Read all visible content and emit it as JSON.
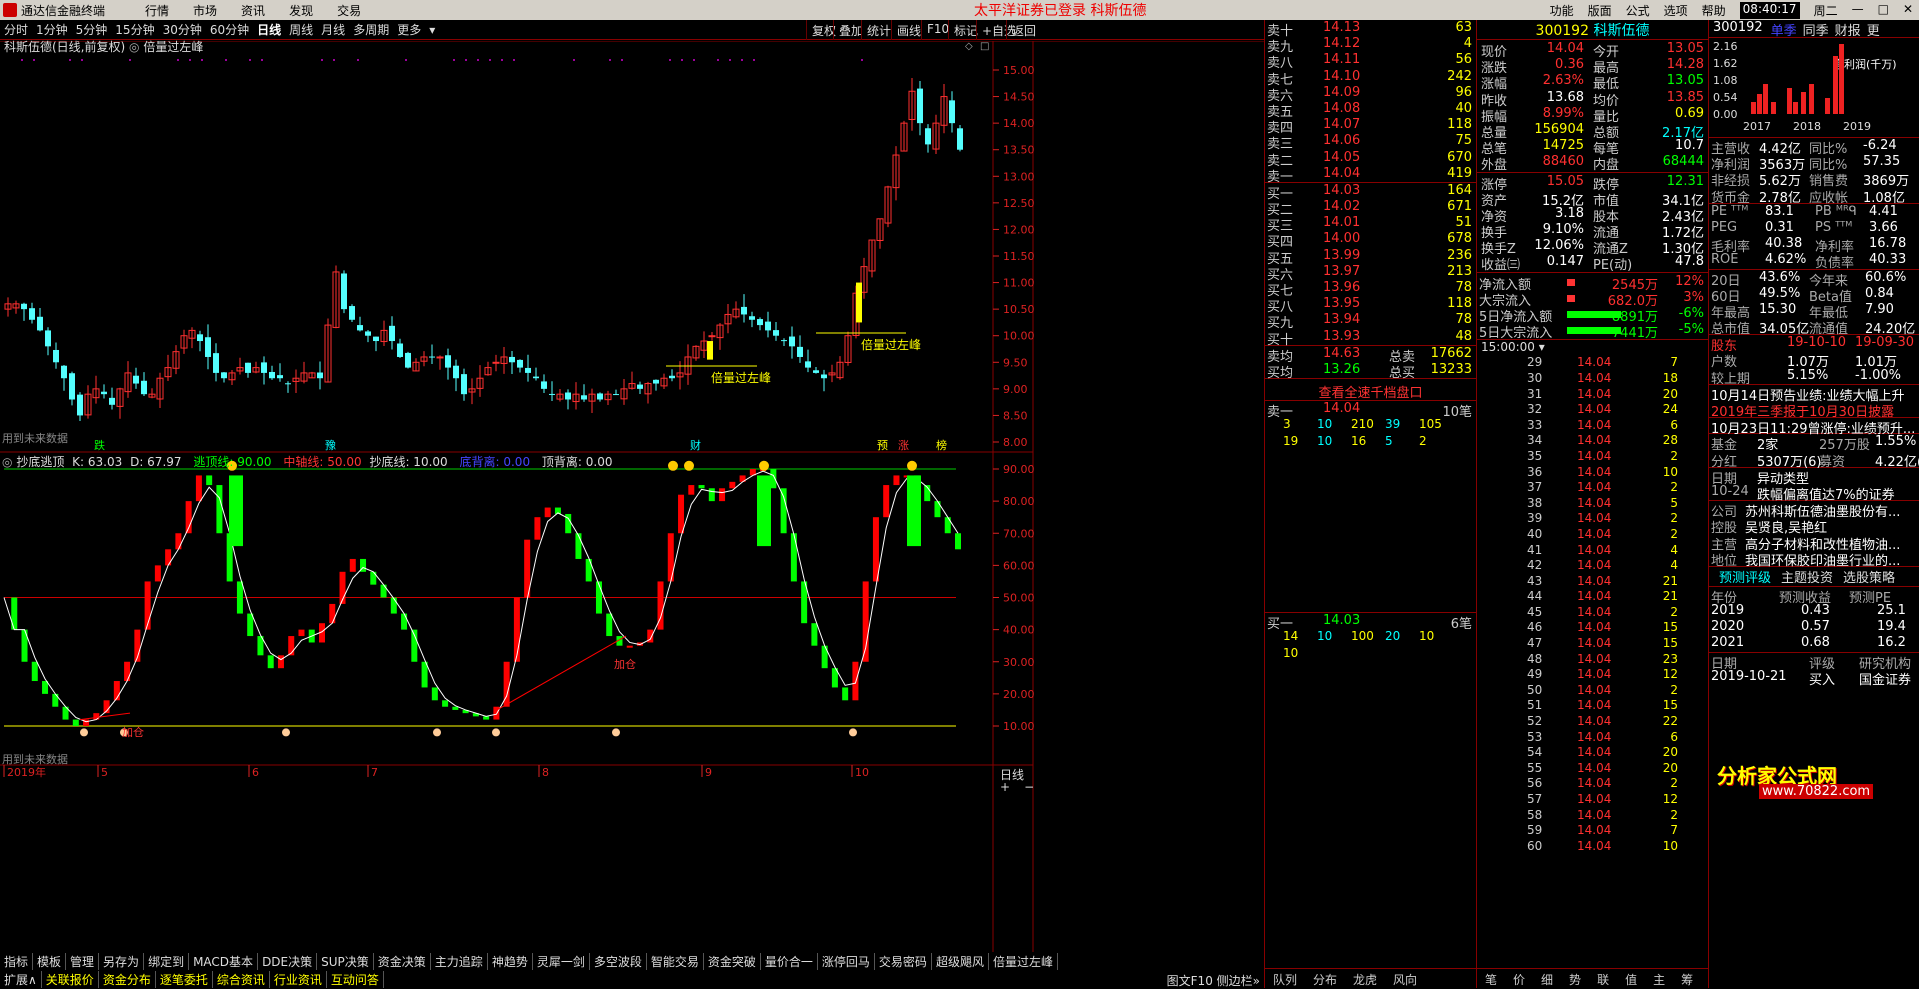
{
  "app": {
    "title": "通达信金融终端",
    "menu": [
      "行情",
      "市场",
      "资讯",
      "发现",
      "交易"
    ],
    "notice": "太平洋证券已登录   科斯伍德",
    "right_menu": [
      "功能",
      "版面",
      "公式",
      "选项",
      "帮助"
    ],
    "clock": "08:40:17",
    "weekday": "周二",
    "win_min": "—",
    "win_max": "□",
    "win_close": "✕"
  },
  "periods": [
    "分时",
    "1分钟",
    "5分钟",
    "15分钟",
    "30分钟",
    "60分钟",
    "日线",
    "周线",
    "月线",
    "多周期",
    "更多"
  ],
  "active_period": "日线",
  "tools": [
    "复权",
    "叠加",
    "统计",
    "画线",
    "F10",
    "标记",
    "+自选",
    "返回"
  ],
  "chart_title": "科斯伍德(日线,前复权)",
  "chart_title_indicator": "倍量过左峰",
  "price_ticks": [
    "15.00",
    "14.50",
    "14.00",
    "13.50",
    "13.00",
    "12.50",
    "12.00",
    "11.50",
    "11.00",
    "10.50",
    "10.00",
    "9.50",
    "9.00",
    "8.50",
    "8.00"
  ],
  "future_text": "用到未来数据",
  "signal_labels": [
    {
      "text": "跌",
      "color": "#0f0"
    },
    {
      "text": "豫",
      "color": "#0ff"
    },
    {
      "text": "财",
      "color": "#0ff"
    },
    {
      "text": "预",
      "color": "#ff0"
    },
    {
      "text": "涨",
      "color": "#f33"
    },
    {
      "text": "榜",
      "color": "#ff0"
    }
  ],
  "annot1": "倍量过左峰",
  "annot2": "倍量过左峰",
  "indicator": {
    "name": "抄底逃顶",
    "k": "K: 63.03",
    "d": "D: 67.97",
    "escape": "逃顶线: 90.00",
    "mid": "中轴线: 50.00",
    "bottom": "抄底线: 10.00",
    "bot_div": "底背离: 0.00",
    "top_div": "顶背离: 0.00",
    "add_label": "加仓",
    "add_label2": "加仓"
  },
  "ind_ticks": [
    "90.00",
    "80.00",
    "70.00",
    "60.00",
    "50.00",
    "40.00",
    "30.00",
    "20.00",
    "10.00"
  ],
  "months": [
    "2019年",
    "5",
    "6",
    "7",
    "8",
    "9",
    "10"
  ],
  "dayline_label": "日线",
  "scroll_btns": [
    "+",
    "−"
  ],
  "bottom_tabs1": [
    "指标",
    "模板",
    "管理",
    "另存为",
    "绑定到",
    "MACD基本",
    "DDE决策",
    "SUP决策",
    "资金决策",
    "主力追踪",
    "神趋势",
    "灵犀一剑",
    "多空波段",
    "智能交易",
    "资金突破",
    "量价合一",
    "涨停回马",
    "交易密码",
    "超级飓风",
    "倍量过左峰"
  ],
  "bottom_tabs2": [
    "扩展∧",
    "关联报价",
    "资金分布",
    "逐笔委托",
    "综合资讯",
    "行业资讯",
    "互动问答"
  ],
  "bottom_right": "图文F10 侧边栏»",
  "quote": {
    "sell": [
      [
        "卖十",
        "14.13",
        "63"
      ],
      [
        "卖九",
        "14.12",
        "4"
      ],
      [
        "卖八",
        "14.11",
        "56"
      ],
      [
        "卖七",
        "14.10",
        "242"
      ],
      [
        "卖六",
        "14.09",
        "96"
      ],
      [
        "卖五",
        "14.08",
        "40"
      ],
      [
        "卖四",
        "14.07",
        "118"
      ],
      [
        "卖三",
        "14.06",
        "75"
      ],
      [
        "卖二",
        "14.05",
        "670"
      ],
      [
        "卖一",
        "14.04",
        "419"
      ]
    ],
    "buy": [
      [
        "买一",
        "14.03",
        "164"
      ],
      [
        "买二",
        "14.02",
        "671"
      ],
      [
        "买三",
        "14.01",
        "51"
      ],
      [
        "买四",
        "14.00",
        "678"
      ],
      [
        "买五",
        "13.99",
        "236"
      ],
      [
        "买六",
        "13.97",
        "213"
      ],
      [
        "买七",
        "13.96",
        "78"
      ],
      [
        "买八",
        "13.95",
        "118"
      ],
      [
        "买九",
        "13.94",
        "78"
      ],
      [
        "买十",
        "13.93",
        "48"
      ]
    ],
    "avg": [
      [
        "卖均",
        "14.63",
        "总卖",
        "17662"
      ],
      [
        "买均",
        "13.26",
        "总买",
        "13233"
      ]
    ],
    "link": "查看全速千档盘口",
    "sell1_row": [
      "卖一",
      "14.04",
      "10笔"
    ],
    "sell1_q": [
      [
        "3",
        "10",
        "210",
        "39",
        "105"
      ],
      [
        "19",
        "10",
        "16",
        "5",
        "2"
      ]
    ],
    "buy1_row": [
      "买一",
      "14.03",
      "6笔"
    ],
    "buy1_q": [
      [
        "14",
        "10",
        "100",
        "20",
        "10"
      ],
      [
        "10"
      ]
    ]
  },
  "detail": {
    "code": "300192",
    "name": "科斯伍德",
    "stats": [
      [
        "现价",
        "14.04",
        "今开",
        "13.05"
      ],
      [
        "涨跌",
        "0.36",
        "最高",
        "14.28"
      ],
      [
        "涨幅",
        "2.63%",
        "最低",
        "13.05"
      ],
      [
        "昨收",
        "13.68",
        "均价",
        "13.85"
      ],
      [
        "振幅",
        "8.99%",
        "量比",
        "0.69"
      ],
      [
        "总量",
        "156904",
        "总额",
        "2.17亿"
      ],
      [
        "总笔",
        "14725",
        "每笔",
        "10.7"
      ],
      [
        "外盘",
        "88460",
        "内盘",
        "68444"
      ]
    ],
    "stats2": [
      [
        "涨停",
        "15.05",
        "跌停",
        "12.31"
      ],
      [
        "资产",
        "15.2亿",
        "市值",
        "34.1亿"
      ],
      [
        "净资",
        "3.18",
        "股本",
        "2.43亿"
      ],
      [
        "换手",
        "9.10%",
        "流通",
        "1.72亿"
      ],
      [
        "换手Z",
        "12.06%",
        "流通Z",
        "1.30亿"
      ],
      [
        "收益㈢",
        "0.147",
        "PE(动)",
        "47.8"
      ]
    ],
    "flows": [
      [
        "净流入额",
        "2545万",
        "12%"
      ],
      [
        "大宗流入",
        "682.0万",
        "3%"
      ],
      [
        "5日净流入额",
        "-8891万",
        "-6%"
      ],
      [
        "5日大宗流入",
        "-7441万",
        "-5%"
      ]
    ],
    "ticks_header": "15:00:00",
    "ticks": [
      [
        "29",
        "14.04",
        "7"
      ],
      [
        "30",
        "14.04",
        "18"
      ],
      [
        "31",
        "14.04",
        "20"
      ],
      [
        "32",
        "14.04",
        "24"
      ],
      [
        "33",
        "14.04",
        "6"
      ],
      [
        "34",
        "14.04",
        "28"
      ],
      [
        "35",
        "14.04",
        "2"
      ],
      [
        "36",
        "14.04",
        "10"
      ],
      [
        "37",
        "14.04",
        "2"
      ],
      [
        "38",
        "14.04",
        "5"
      ],
      [
        "39",
        "14.04",
        "2"
      ],
      [
        "40",
        "14.04",
        "2"
      ],
      [
        "41",
        "14.04",
        "4"
      ],
      [
        "42",
        "14.04",
        "4"
      ],
      [
        "43",
        "14.04",
        "21"
      ],
      [
        "44",
        "14.04",
        "21"
      ],
      [
        "45",
        "14.04",
        "2"
      ],
      [
        "46",
        "14.04",
        "15"
      ],
      [
        "47",
        "14.04",
        "15"
      ],
      [
        "48",
        "14.04",
        "23"
      ],
      [
        "49",
        "14.04",
        "12"
      ],
      [
        "50",
        "14.04",
        "2"
      ],
      [
        "51",
        "14.04",
        "15"
      ],
      [
        "52",
        "14.04",
        "22"
      ],
      [
        "53",
        "14.04",
        "6"
      ],
      [
        "54",
        "14.04",
        "20"
      ],
      [
        "55",
        "14.04",
        "20"
      ],
      [
        "56",
        "14.04",
        "2"
      ],
      [
        "57",
        "14.04",
        "12"
      ],
      [
        "58",
        "14.04",
        "2"
      ],
      [
        "59",
        "14.04",
        "7"
      ],
      [
        "60",
        "14.04",
        "10"
      ]
    ],
    "tabs": [
      "笔",
      "价",
      "细",
      "势",
      "联",
      "值",
      "主",
      "筹"
    ]
  },
  "f10": {
    "code": "300192",
    "tabs": [
      "单季",
      "同季",
      "财报",
      "更"
    ],
    "chart": {
      "ticks": [
        "2.16",
        "1.62",
        "1.08",
        "0.54",
        "0.00"
      ],
      "label": "净利润(千万)",
      "years": [
        "2017",
        "2018",
        "2019"
      ]
    },
    "fin": [
      [
        "主营收",
        "4.42亿",
        "同比%",
        "-6.24"
      ],
      [
        "净利润",
        "3563万",
        "同比%",
        "57.35"
      ],
      [
        "非经损",
        "5.62万",
        "销售费",
        "3869万"
      ],
      [
        "货币金",
        "2.78亿",
        "应收帐",
        "1.08亿"
      ]
    ],
    "val": [
      [
        "PE ᵀᵀᴹ",
        "83.1",
        "PB ᴹᴿᑫ",
        "4.41"
      ],
      [
        "PEG",
        "0.31",
        "PS ᵀᵀᴹ",
        "3.66"
      ],
      [
        "毛利率",
        "40.38",
        "净利率",
        "16.78"
      ],
      [
        "ROE",
        "4.62%",
        "负债率",
        "40.33"
      ]
    ],
    "perf": [
      [
        "20日",
        "43.6%",
        "今年来",
        "60.6%"
      ],
      [
        "60日",
        "49.5%",
        "Beta值",
        "0.84"
      ],
      [
        "年最高",
        "15.30",
        "年最低",
        "7.90"
      ],
      [
        "总市值",
        "34.05亿",
        "流通值",
        "24.20亿"
      ]
    ],
    "holders": [
      [
        "股东",
        "19-10-10",
        "19-09-30"
      ],
      [
        "户数",
        "1.07万",
        "1.01万"
      ],
      [
        "较上期",
        "5.15%",
        "-1.00%"
      ]
    ],
    "news": [
      "10月14日预告业绩:业绩大幅上升",
      "2019年三季报于10月30日披露"
    ],
    "news2": "10月23日11:29曾涨停:业绩预升...",
    "funds": [
      [
        "基金",
        "2家",
        "257万股",
        "1.55%"
      ],
      [
        "分红",
        "5307万(6)",
        "募资",
        "4.22亿(1)"
      ]
    ],
    "dragon": [
      [
        "日期",
        "异动类型"
      ],
      [
        "10-24",
        "跌幅偏离值达7%的证券"
      ]
    ],
    "company": [
      [
        "公司",
        "苏州科斯伍德油墨股份有..."
      ],
      [
        "控股",
        "吴贤良,吴艳红"
      ],
      [
        "主营",
        "高分子材料和改性植物油..."
      ],
      [
        "地位",
        "我国环保胶印油墨行业的..."
      ]
    ],
    "tabs2": [
      "预测评级",
      "主题投资",
      "选股策略"
    ],
    "forecast_head": [
      "年份",
      "预测收益",
      "预测PE"
    ],
    "forecast": [
      [
        "2019",
        "0.43",
        "25.1"
      ],
      [
        "2020",
        "0.57",
        "19.4"
      ],
      [
        "2021",
        "0.68",
        "16.2"
      ]
    ],
    "rating_head": [
      "日期",
      "评级",
      "研究机构"
    ],
    "rating": [
      "2019-10-21",
      "买入",
      "国金证券"
    ],
    "watermark": "分析家公式网",
    "watermark_url": "www.70822.com"
  }
}
